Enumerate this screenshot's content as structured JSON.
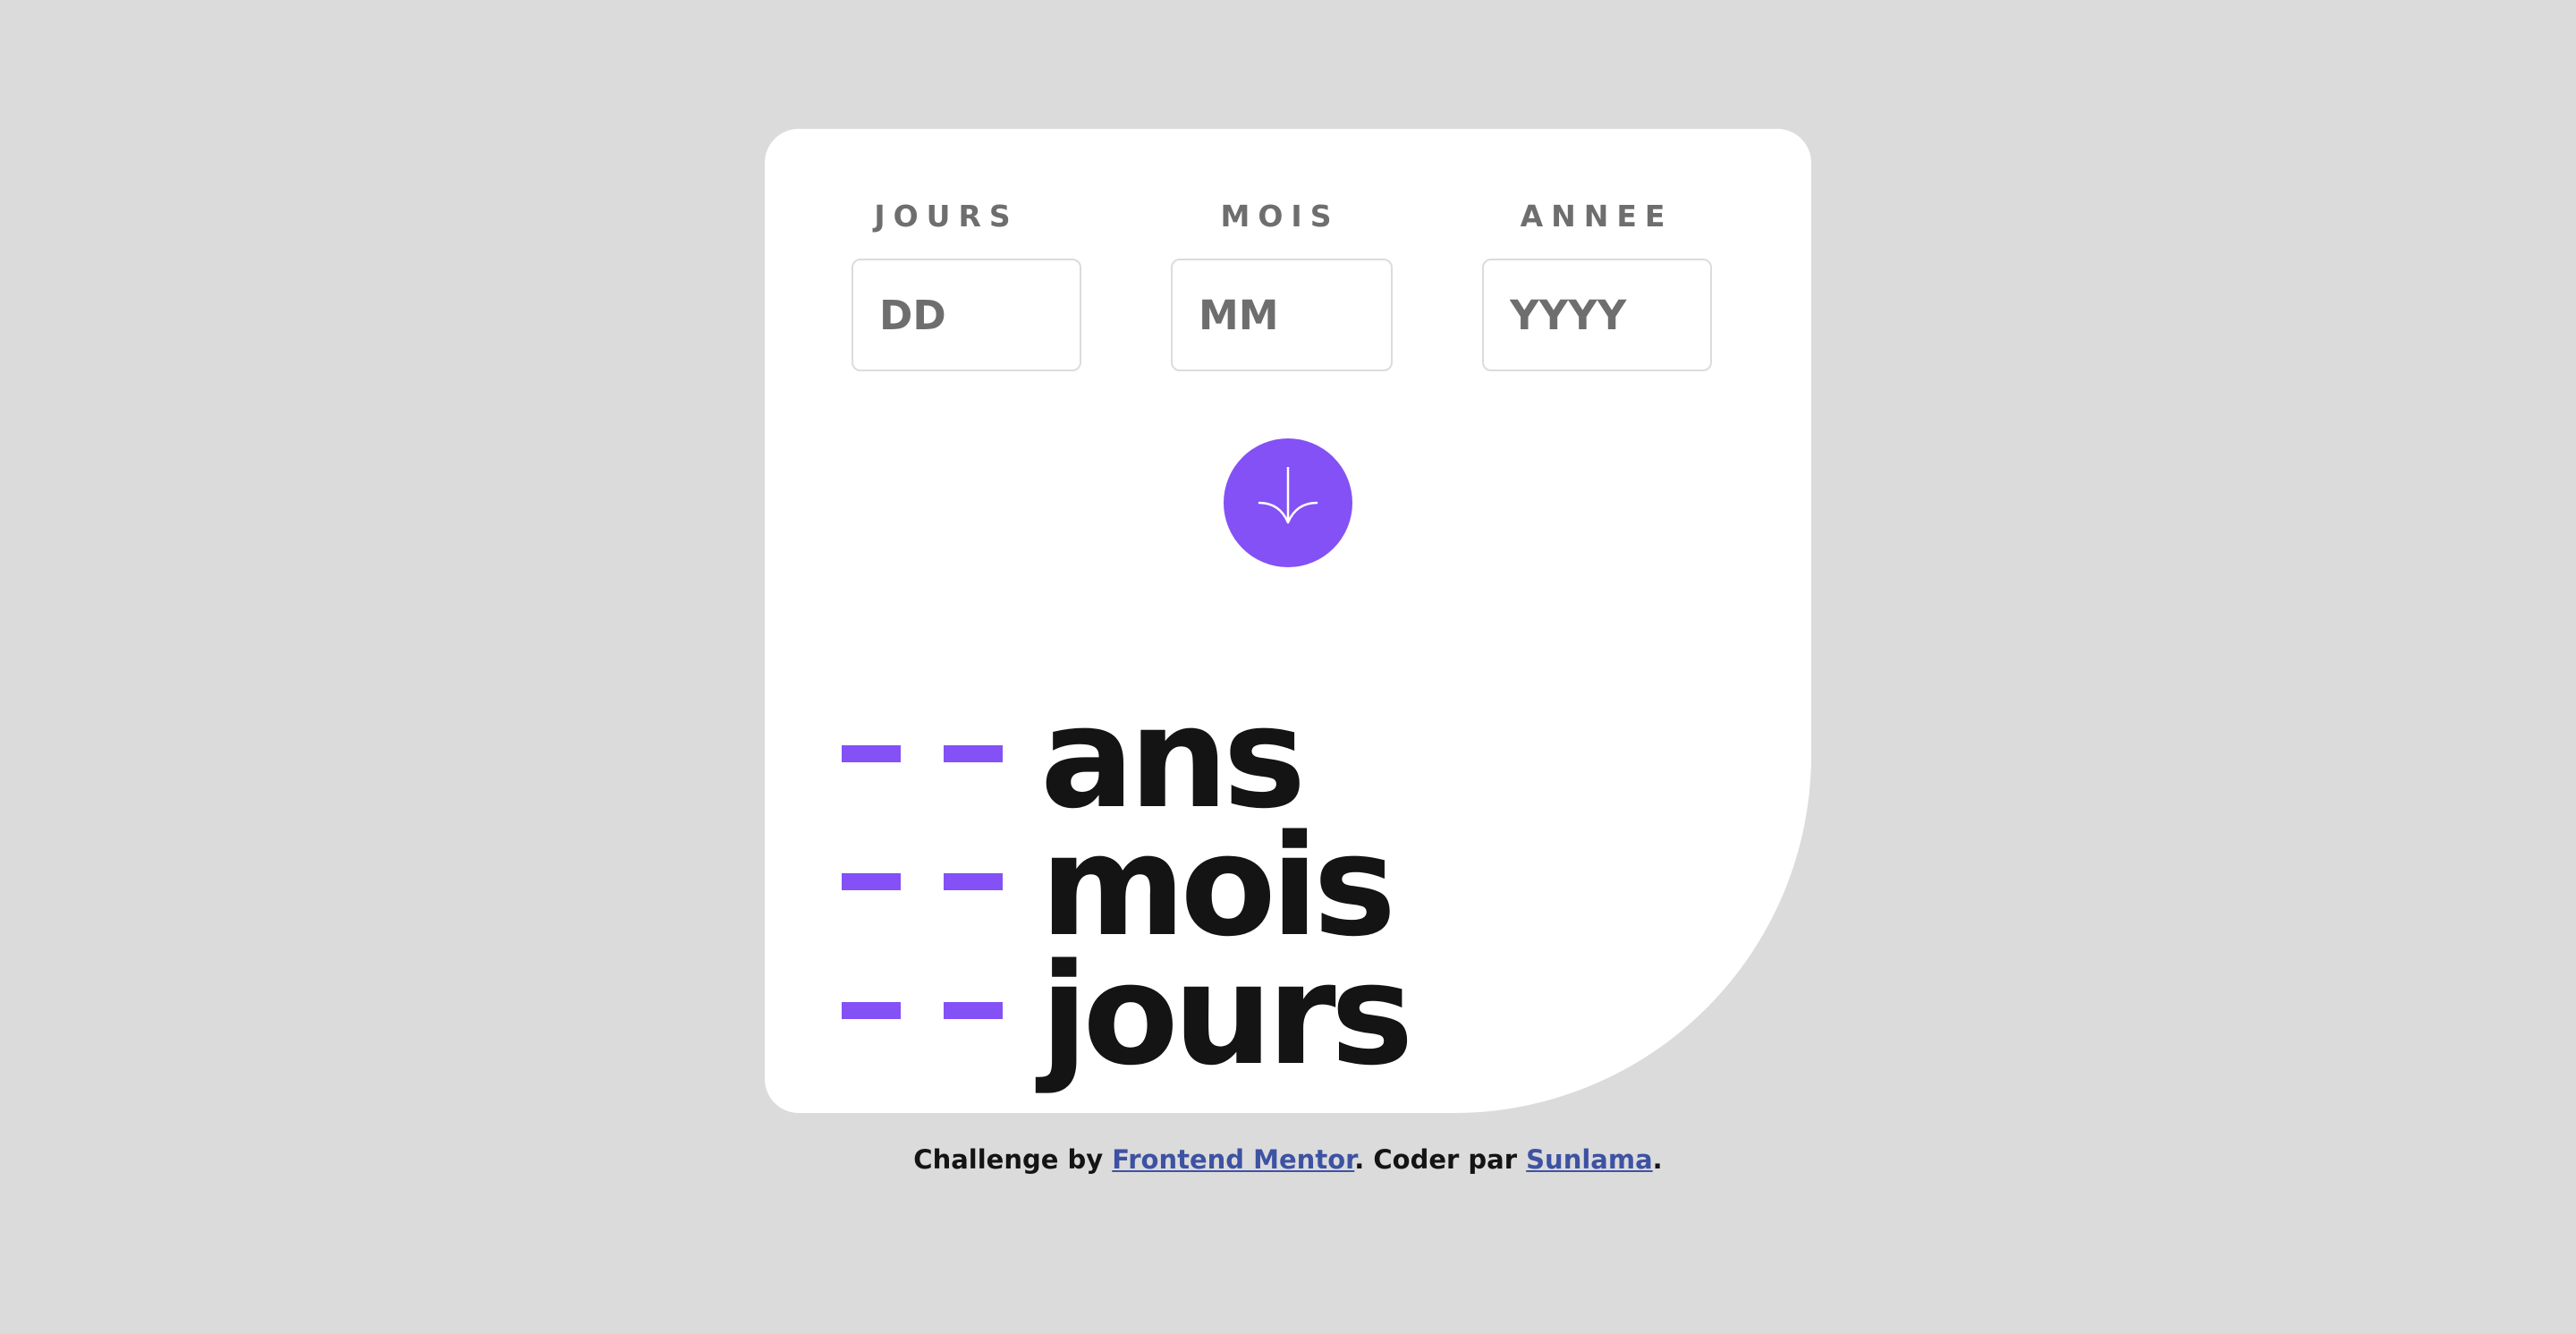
{
  "form": {
    "day": {
      "label": "JOURS",
      "placeholder": "DD",
      "value": ""
    },
    "month": {
      "label": "MOIS",
      "placeholder": "MM",
      "value": ""
    },
    "year": {
      "label": "ANNEE",
      "placeholder": "YYYY",
      "value": ""
    },
    "submit_icon": "arrow-down-icon"
  },
  "results": [
    {
      "value": "- -",
      "unit": "ans"
    },
    {
      "value": "- -",
      "unit": "mois"
    },
    {
      "value": "- -",
      "unit": "jours"
    }
  ],
  "footer": {
    "prefix": "Challenge by",
    "link1": "Frontend Mentor",
    "middle": ". Coder par",
    "link2": "Sunlama",
    "suffix": "."
  },
  "colors": {
    "background": "#dbdbdb",
    "card": "#ffffff",
    "accent": "#8351f5",
    "label": "#6e6e6e",
    "text": "#141414",
    "link": "#3e52a3"
  }
}
